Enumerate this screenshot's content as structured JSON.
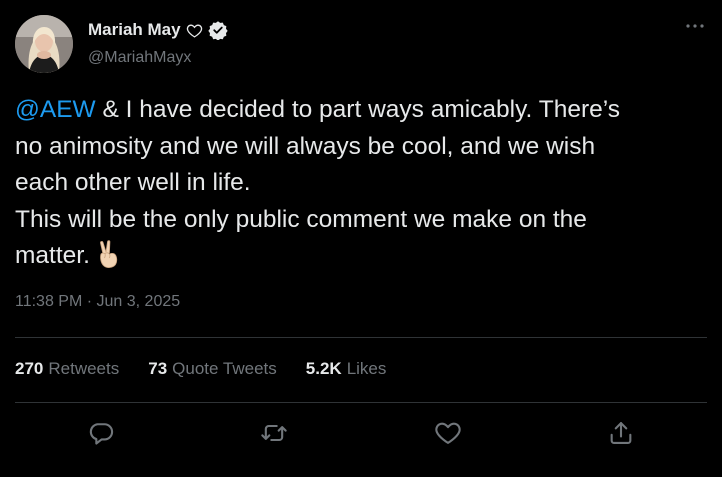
{
  "author": {
    "display_name": "Mariah May",
    "handle": "@MariahMayx",
    "avatar_icon": "avatar-photo",
    "name_badges": [
      "heart-outline-icon",
      "verified-badge-icon"
    ]
  },
  "menu": {
    "icon": "more-dots-icon"
  },
  "tweet": {
    "mention": "@AEW",
    "line1_rest": " & I have decided to part ways amicably. There’s",
    "line2": "no animosity and we will always be cool, and we wish",
    "line3": "each other well in life.",
    "line4": "This will be the only public comment we make on the",
    "line5": "matter.",
    "emoji": "victory-hand-emoji"
  },
  "timestamp": "11:38 PM · Jun 3, 2025",
  "stats": [
    {
      "value": "270",
      "label": "Retweets"
    },
    {
      "value": "73",
      "label": "Quote Tweets"
    },
    {
      "value": "5.2K",
      "label": "Likes"
    }
  ],
  "actions": [
    "reply-icon",
    "retweet-icon",
    "like-icon",
    "share-icon"
  ],
  "colors": {
    "background": "#000000",
    "text": "#e7e9ea",
    "secondary": "#71767b",
    "accent": "#1d9bf0",
    "divider": "#2f3336"
  }
}
